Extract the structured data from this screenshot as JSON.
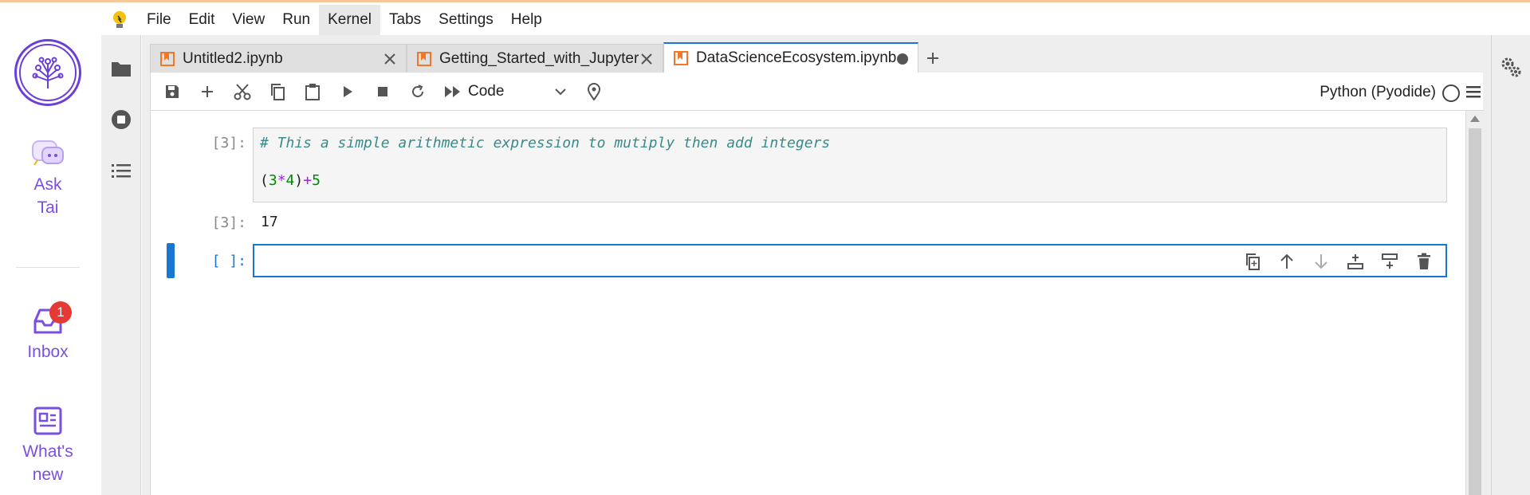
{
  "app_rail": {
    "ask_label": "Ask Tai",
    "inbox_label": "Inbox",
    "inbox_badge": "1",
    "whats_new_label": "What's new",
    "accent_color": "#7a4fe0"
  },
  "menubar": {
    "items": [
      "File",
      "Edit",
      "View",
      "Run",
      "Kernel",
      "Tabs",
      "Settings",
      "Help"
    ],
    "active_item": "Kernel"
  },
  "tabs": [
    {
      "label": "Untitled2.ipynb",
      "state": "close"
    },
    {
      "label": "Getting_Started_with_Jupyter",
      "state": "close"
    },
    {
      "label": "DataScienceEcosystem.ipynb",
      "state": "unsaved",
      "active": true
    }
  ],
  "toolbar": {
    "cell_type": "Code",
    "kernel": "Python (Pyodide)"
  },
  "cells": {
    "cell1": {
      "in_prompt": "[3]:",
      "comment": "# This a simple arithmetic expression to mutiply then add integers",
      "code_open": "(",
      "code_a": "3",
      "code_mul": "*",
      "code_b": "4",
      "code_close": ")",
      "code_plus": "+",
      "code_c": "5",
      "out_prompt": "[3]:",
      "output": "17"
    },
    "cell2": {
      "in_prompt": "[ ]:"
    }
  },
  "colors": {
    "active_blue": "#1976d2",
    "badge_red": "#e53935",
    "file_icon_orange": "#f37726"
  }
}
